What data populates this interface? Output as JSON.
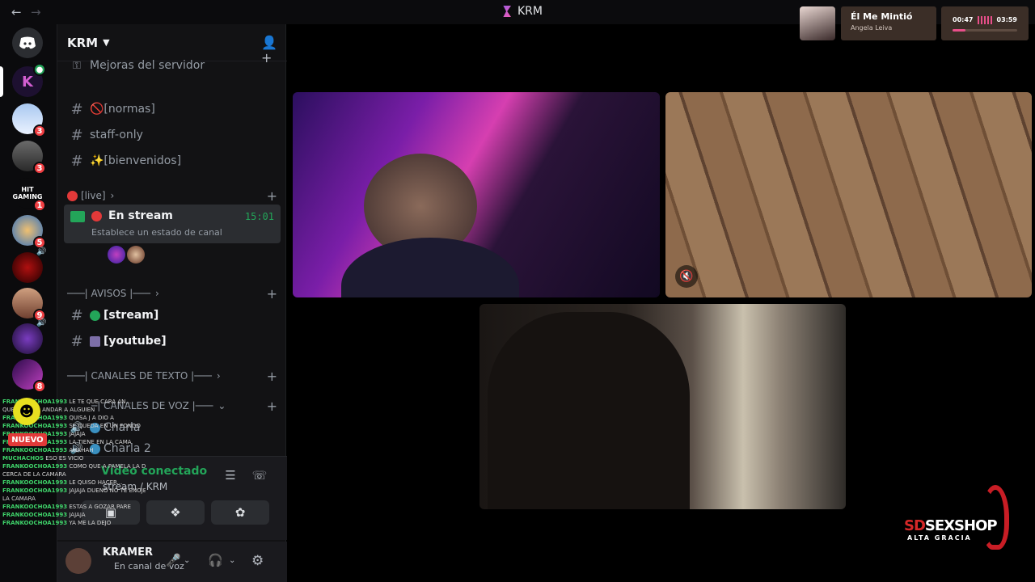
{
  "window": {
    "title": "KRM"
  },
  "rail": {
    "servers": [
      {
        "name": "discord-home",
        "badge": ""
      },
      {
        "name": "krm",
        "badge": ""
      },
      {
        "name": "server-3",
        "badge": "3"
      },
      {
        "name": "server-4",
        "badge": "3"
      },
      {
        "name": "hit-gaming",
        "badge": "1"
      },
      {
        "name": "server-6",
        "badge": "5"
      },
      {
        "name": "server-7",
        "badge": ""
      },
      {
        "name": "server-8",
        "badge": "9"
      },
      {
        "name": "server-9",
        "badge": ""
      },
      {
        "name": "server-10",
        "badge": "8"
      }
    ],
    "hit_label": "HIT\nGAMING"
  },
  "guild": {
    "name": "KRM"
  },
  "channels": {
    "boost": "Mejoras del servidor",
    "normas": "🚫[normas]",
    "staff": "staff-only",
    "bienvenidos": "✨[bienvenidos]",
    "live_cat": "[live]",
    "voice_active": {
      "name": "En stream",
      "time": "15:01",
      "status": "Establece un estado de canal"
    },
    "avisos_cat": "───| AVISOS |───",
    "stream": "[stream]",
    "youtube": "[youtube]",
    "texto_cat": "───| CANALES DE TEXTO |───",
    "voz_cat": "─| CANALES DE VOZ |───",
    "charla": "Charla",
    "charla2": "Charla 2"
  },
  "rtc": {
    "status": "Vídeo conectado",
    "channel": "stream / KRM"
  },
  "user": {
    "name": "KRAMER",
    "status": "En canal de voz"
  },
  "overlay": {
    "nuevo": "NUEVO",
    "chat": [
      {
        "user": "FRANKOOCHOA1993",
        "msg": "LE TE QUE CARA AN..."
      },
      {
        "user": "",
        "msg": "QUE TE IBA A ANDAR A ALGUIEN"
      },
      {
        "user": "FRANKOOCHOA1993",
        "msg": "QUISA J A DIO A"
      },
      {
        "user": "FRANKOOCHOA1993",
        "msg": "SE QUEDA EN UN FONDO"
      },
      {
        "user": "FRANKOOCHOA1993",
        "msg": "JAJAJA"
      },
      {
        "user": "FRANKOOCHOA1993",
        "msg": "LA TIENE EN LA CAMA"
      },
      {
        "user": "FRANKOOCHOA1993",
        "msg": "AHAHAH"
      },
      {
        "user": "MUCHACHOS",
        "msg": "ESO ES VICIO"
      },
      {
        "user": "FRANKOOCHOA1993",
        "msg": "COMO QUE A PAMELA LA DEJ MAS"
      },
      {
        "user": "",
        "msg": "CERCA DE LA CAMARA"
      },
      {
        "user": "FRANKOOCHOA1993",
        "msg": "LE QUISO HACER..."
      },
      {
        "user": "FRANKOOCHOA1993",
        "msg": "JAJAJA DUENO NO TE ENOJES"
      },
      {
        "user": "",
        "msg": "LA CAMARA"
      },
      {
        "user": "FRANKOOCHOA1993",
        "msg": "ESTAS A GOZAR PARE"
      },
      {
        "user": "FRANKOOCHOA1993",
        "msg": "JAJAJA"
      },
      {
        "user": "FRANKOOCHOA1993",
        "msg": "YA ME LA DEJO"
      }
    ]
  },
  "now_playing": {
    "title": "Él Me Mintió",
    "artist": "Angela Leiva",
    "current": "00:47",
    "duration": "03:59",
    "progress": 0.2
  },
  "sponsor": {
    "name_sd": "SD",
    "name": "SEXSHOP",
    "sub": "ALTA GRACIA"
  },
  "colors": {
    "accent_green": "#23a559",
    "badge_red": "#f23f43",
    "np_pink": "#e84f8a"
  }
}
